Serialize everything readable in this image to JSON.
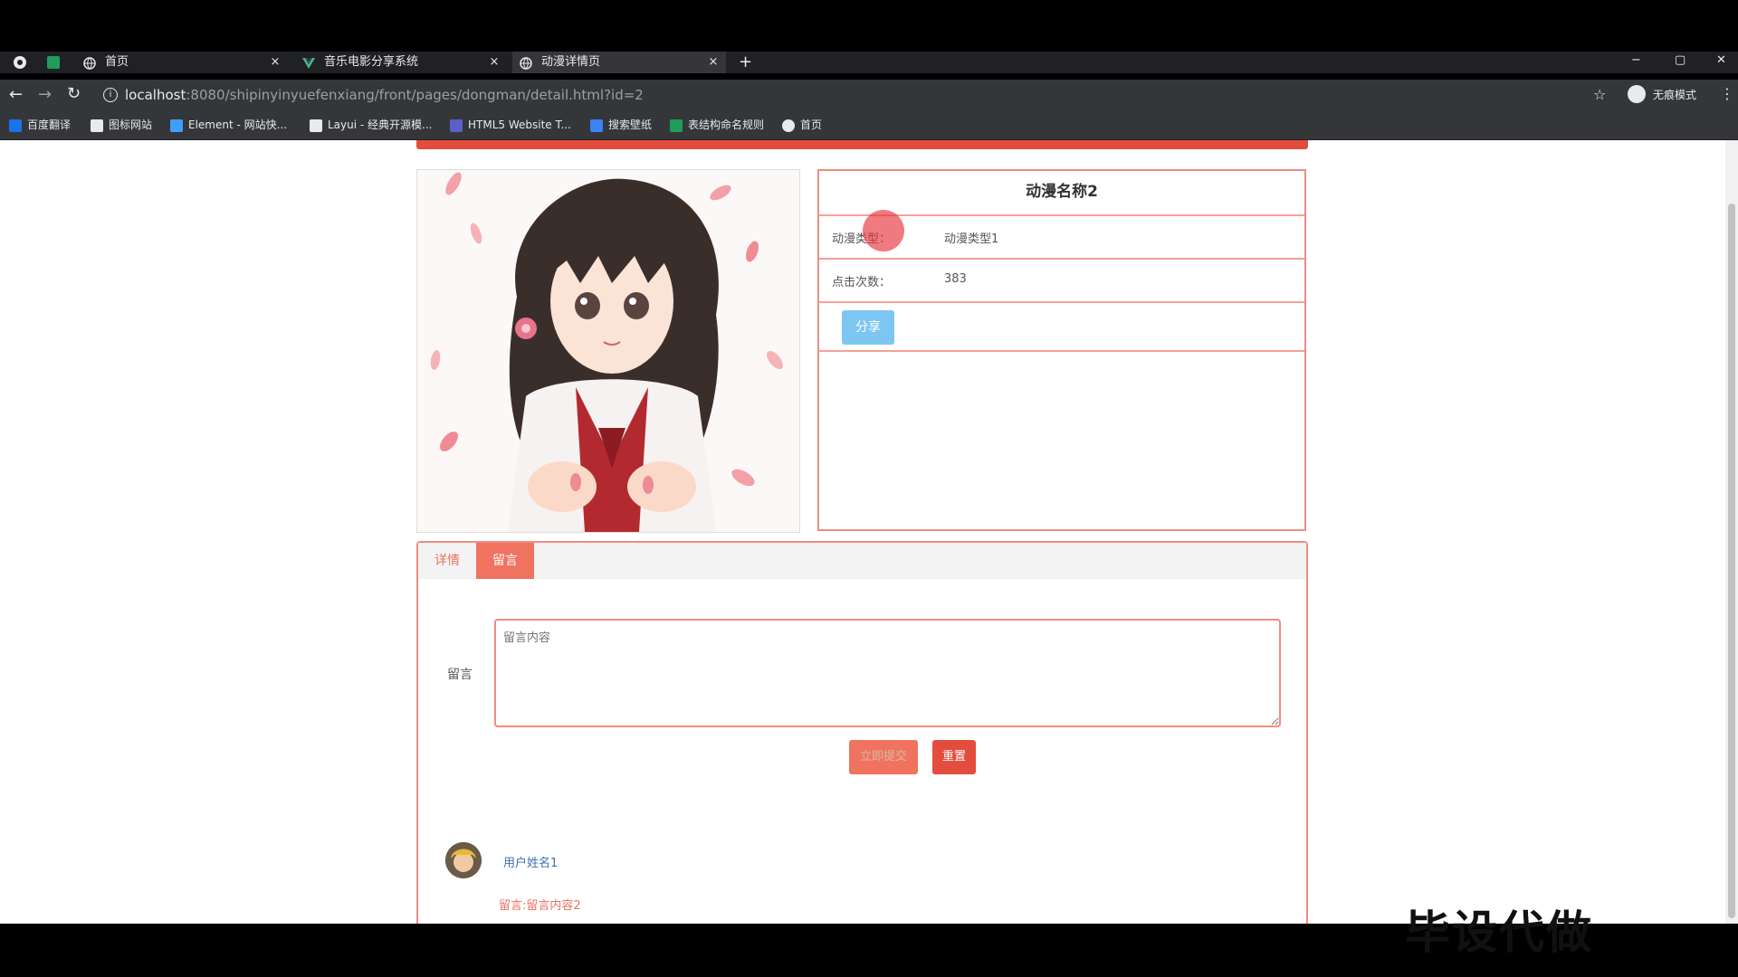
{
  "browser": {
    "tabs": [
      {
        "label": "首页",
        "active": false
      },
      {
        "label": "音乐电影分享系统",
        "active": false
      },
      {
        "label": "动漫详情页",
        "active": true
      }
    ],
    "new_tab_symbol": "+",
    "close_symbol": "×",
    "url_host": "localhost",
    "url_rest": ":8080/shipinyinyuefenxiang/front/pages/dongman/detail.html?id=2",
    "profile_label": "无痕模式",
    "window_controls": [
      "−",
      "▢",
      "✕"
    ],
    "bookmarks": [
      {
        "label": "百度翻译",
        "icon": "translate-icon",
        "color": "#1a73e8"
      },
      {
        "label": "图标网站",
        "icon": "flag-icon",
        "color": "#e8eaed"
      },
      {
        "label": "Element - 网站快...",
        "icon": "element-icon",
        "color": "#409eff"
      },
      {
        "label": "Layui - 经典开源模...",
        "icon": "layui-icon",
        "color": "#e8eaed"
      },
      {
        "label": "HTML5 Website T...",
        "icon": "html5-icon",
        "color": "#5b5fc7"
      },
      {
        "label": "搜索壁纸",
        "icon": "wallpaper-icon",
        "color": "#3b82f6"
      },
      {
        "label": "表结构命名规则",
        "icon": "sheet-icon",
        "color": "#1e9e5a"
      },
      {
        "label": "首页",
        "icon": "globe-icon",
        "color": "#e8eaed"
      }
    ]
  },
  "detail": {
    "title": "动漫名称2",
    "rows": [
      {
        "key": "动漫类型：",
        "value": "动漫类型1"
      },
      {
        "key": "点击次数：",
        "value": "383"
      }
    ],
    "share_label": "分享"
  },
  "tabs": {
    "items": [
      "详情",
      "留言"
    ],
    "active_index": 1
  },
  "comment_form": {
    "label": "留言",
    "placeholder": "留言内容",
    "submit_label": "立即提交",
    "reset_label": "重置"
  },
  "comments": [
    {
      "username": "用户姓名1",
      "text": "留言:留言内容2"
    }
  ],
  "watermark": "毕设代做",
  "colors": {
    "accent": "#e34d3d",
    "border": "#f08c82",
    "share": "#7ec6f2"
  }
}
